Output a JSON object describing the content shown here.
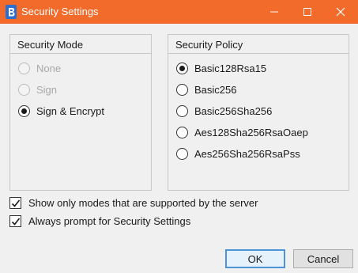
{
  "window": {
    "title": "Security Settings",
    "app_icon": "app-logo-icon",
    "controls": [
      "minimize-icon",
      "maximize-icon",
      "close-icon"
    ],
    "titlebar_color": "#f26b2b"
  },
  "security_mode": {
    "header": "Security Mode",
    "options": [
      {
        "label": "None",
        "checked": false,
        "disabled": true
      },
      {
        "label": "Sign",
        "checked": false,
        "disabled": true
      },
      {
        "label": "Sign & Encrypt",
        "checked": true,
        "disabled": false
      }
    ]
  },
  "security_policy": {
    "header": "Security Policy",
    "options": [
      {
        "label": "Basic128Rsa15",
        "checked": true
      },
      {
        "label": "Basic256",
        "checked": false
      },
      {
        "label": "Basic256Sha256",
        "checked": false
      },
      {
        "label": "Aes128Sha256RsaOaep",
        "checked": false
      },
      {
        "label": "Aes256Sha256RsaPss",
        "checked": false
      }
    ]
  },
  "options": {
    "supported_only": {
      "label": "Show only modes that are supported by the server",
      "checked": true
    },
    "always_prompt": {
      "label": "Always prompt for Security Settings",
      "checked": true
    }
  },
  "buttons": {
    "ok": "OK",
    "cancel": "Cancel"
  }
}
